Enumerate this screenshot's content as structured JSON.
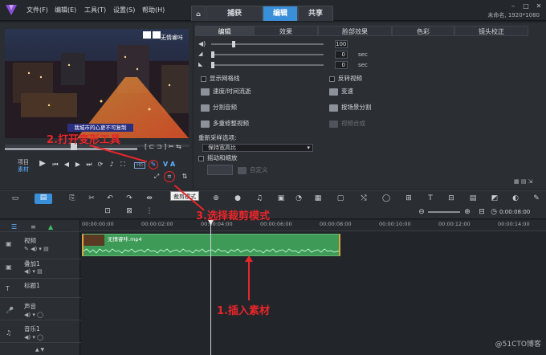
{
  "menubar": {
    "items": [
      "文件(F)",
      "编辑(E)",
      "工具(T)",
      "设置(S)",
      "帮助(H)"
    ],
    "tabs": [
      "捕获",
      "编辑",
      "共享"
    ],
    "active_tab": "编辑",
    "project_info": "未命名, 1920*1080"
  },
  "preview": {
    "overlay_title": "无情睿咔",
    "subtitle": "我城市的心更不可复制",
    "project_label": "项目",
    "clip_label": "素材",
    "hd_badge": "HD",
    "va_label": "V A"
  },
  "options": {
    "tabs": [
      "编辑",
      "效果",
      "脸部效果",
      "色彩",
      "镜头校正"
    ],
    "active_tab": "编辑",
    "truncated_header": "",
    "volume_value": "100",
    "fade_in_value": "0",
    "fade_out_value": "0",
    "unit": "sec",
    "items_left": [
      "显示网格线",
      "速度/时间流逝",
      "分割音频",
      "多重修整视频"
    ],
    "items_right": [
      "反转视频",
      "变速",
      "按场景分割",
      "视频合成"
    ],
    "resample_label": "重新采样选项:",
    "resample_value": "保持宽高比",
    "pan_zoom_label": "摇动和缩放",
    "custom_label": "自定义"
  },
  "toolbar": {
    "crop_tooltip": "裁剪模式",
    "zoom_value": "0:00:08:00"
  },
  "timeline": {
    "ruler": [
      "00:00:00:00",
      "00:00:02:00",
      "00:00:04:00",
      "00:00:06:00",
      "00:00:08:00",
      "00:00:10:00",
      "00:00:12:00",
      "00:00:14:00"
    ],
    "tracks": [
      "视频",
      "叠加1",
      "标题1",
      "声音",
      "音乐1"
    ],
    "clip_name": "无情睿咔.mp4"
  },
  "annotations": {
    "step1": "1.插入素材",
    "step2": "2.打开变形工具",
    "step3": "3.选择裁剪模式"
  },
  "watermark": "@51CTO博客"
}
